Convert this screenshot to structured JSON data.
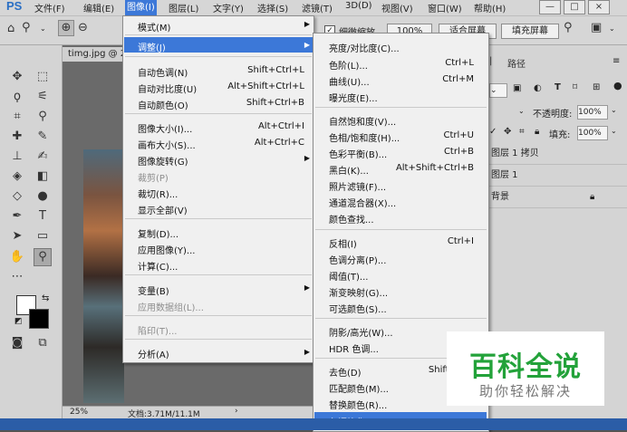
{
  "menubar": {
    "logo": "PS",
    "items": [
      "文件(F)",
      "编辑(E)",
      "图像(I)",
      "图层(L)",
      "文字(Y)",
      "选择(S)",
      "滤镜(T)",
      "3D(D)",
      "视图(V)",
      "窗口(W)",
      "帮助(H)"
    ],
    "active_item": "图像(I)",
    "window_buttons": [
      "—",
      "□",
      "×"
    ]
  },
  "options_bar": {
    "scrubby_zoom_label": "细微缩放",
    "zoom_value": "100%",
    "fit_screen_label": "适合屏幕",
    "fill_screen_label": "填充屏幕"
  },
  "document": {
    "tab_title": "timg.jpg @ 2",
    "zoom": "25%",
    "doc_info": "文档:3.71M/11.1M"
  },
  "image_menu": {
    "items": [
      {
        "label": "模式(M)",
        "shortcut": "",
        "submenu": true,
        "disabled": false
      },
      {
        "label": "调整(J)",
        "shortcut": "",
        "submenu": true,
        "disabled": false,
        "highlighted": true
      },
      {
        "label": "自动色调(N)",
        "shortcut": "Shift+Ctrl+L",
        "submenu": false,
        "disabled": false
      },
      {
        "label": "自动对比度(U)",
        "shortcut": "Alt+Shift+Ctrl+L",
        "submenu": false,
        "disabled": false
      },
      {
        "label": "自动颜色(O)",
        "shortcut": "Shift+Ctrl+B",
        "submenu": false,
        "disabled": false
      },
      {
        "label": "图像大小(I)...",
        "shortcut": "Alt+Ctrl+I",
        "submenu": false,
        "disabled": false
      },
      {
        "label": "画布大小(S)...",
        "shortcut": "Alt+Ctrl+C",
        "submenu": false,
        "disabled": false
      },
      {
        "label": "图像旋转(G)",
        "shortcut": "",
        "submenu": true,
        "disabled": false
      },
      {
        "label": "裁剪(P)",
        "shortcut": "",
        "submenu": false,
        "disabled": true
      },
      {
        "label": "裁切(R)...",
        "shortcut": "",
        "submenu": false,
        "disabled": false
      },
      {
        "label": "显示全部(V)",
        "shortcut": "",
        "submenu": false,
        "disabled": false
      },
      {
        "label": "复制(D)...",
        "shortcut": "",
        "submenu": false,
        "disabled": false
      },
      {
        "label": "应用图像(Y)...",
        "shortcut": "",
        "submenu": false,
        "disabled": false
      },
      {
        "label": "计算(C)...",
        "shortcut": "",
        "submenu": false,
        "disabled": false
      },
      {
        "label": "变量(B)",
        "shortcut": "",
        "submenu": true,
        "disabled": false
      },
      {
        "label": "应用数据组(L)...",
        "shortcut": "",
        "submenu": false,
        "disabled": true
      },
      {
        "label": "陷印(T)...",
        "shortcut": "",
        "submenu": false,
        "disabled": true
      },
      {
        "label": "分析(A)",
        "shortcut": "",
        "submenu": true,
        "disabled": false
      }
    ]
  },
  "adjust_submenu": {
    "items": [
      {
        "label": "亮度/对比度(C)...",
        "shortcut": ""
      },
      {
        "label": "色阶(L)...",
        "shortcut": "Ctrl+L"
      },
      {
        "label": "曲线(U)...",
        "shortcut": "Ctrl+M"
      },
      {
        "label": "曝光度(E)...",
        "shortcut": ""
      },
      {
        "label": "自然饱和度(V)...",
        "shortcut": ""
      },
      {
        "label": "色相/饱和度(H)...",
        "shortcut": "Ctrl+U"
      },
      {
        "label": "色彩平衡(B)...",
        "shortcut": "Ctrl+B"
      },
      {
        "label": "黑白(K)...",
        "shortcut": "Alt+Shift+Ctrl+B"
      },
      {
        "label": "照片滤镜(F)...",
        "shortcut": ""
      },
      {
        "label": "通道混合器(X)...",
        "shortcut": ""
      },
      {
        "label": "颜色查找...",
        "shortcut": ""
      },
      {
        "label": "反相(I)",
        "shortcut": "Ctrl+I"
      },
      {
        "label": "色调分离(P)...",
        "shortcut": ""
      },
      {
        "label": "阈值(T)...",
        "shortcut": ""
      },
      {
        "label": "渐变映射(G)...",
        "shortcut": ""
      },
      {
        "label": "可选颜色(S)...",
        "shortcut": ""
      },
      {
        "label": "阴影/高光(W)...",
        "shortcut": ""
      },
      {
        "label": "HDR 色调...",
        "shortcut": ""
      },
      {
        "label": "去色(D)",
        "shortcut": "Shift+C"
      },
      {
        "label": "匹配颜色(M)...",
        "shortcut": ""
      },
      {
        "label": "替换颜色(R)...",
        "shortcut": ""
      },
      {
        "label": "色调均化(Q)",
        "shortcut": "",
        "highlighted": true
      }
    ]
  },
  "layers_panel": {
    "tab_paths": "路径",
    "opacity_label": "不透明度:",
    "opacity_value": "100%",
    "fill_label": "填充:",
    "fill_value": "100%",
    "layers": [
      "图层 1 拷贝",
      "图层 1",
      "背景"
    ]
  },
  "watermark": {
    "title": "百科全说",
    "subtitle": "助你轻松解决"
  }
}
